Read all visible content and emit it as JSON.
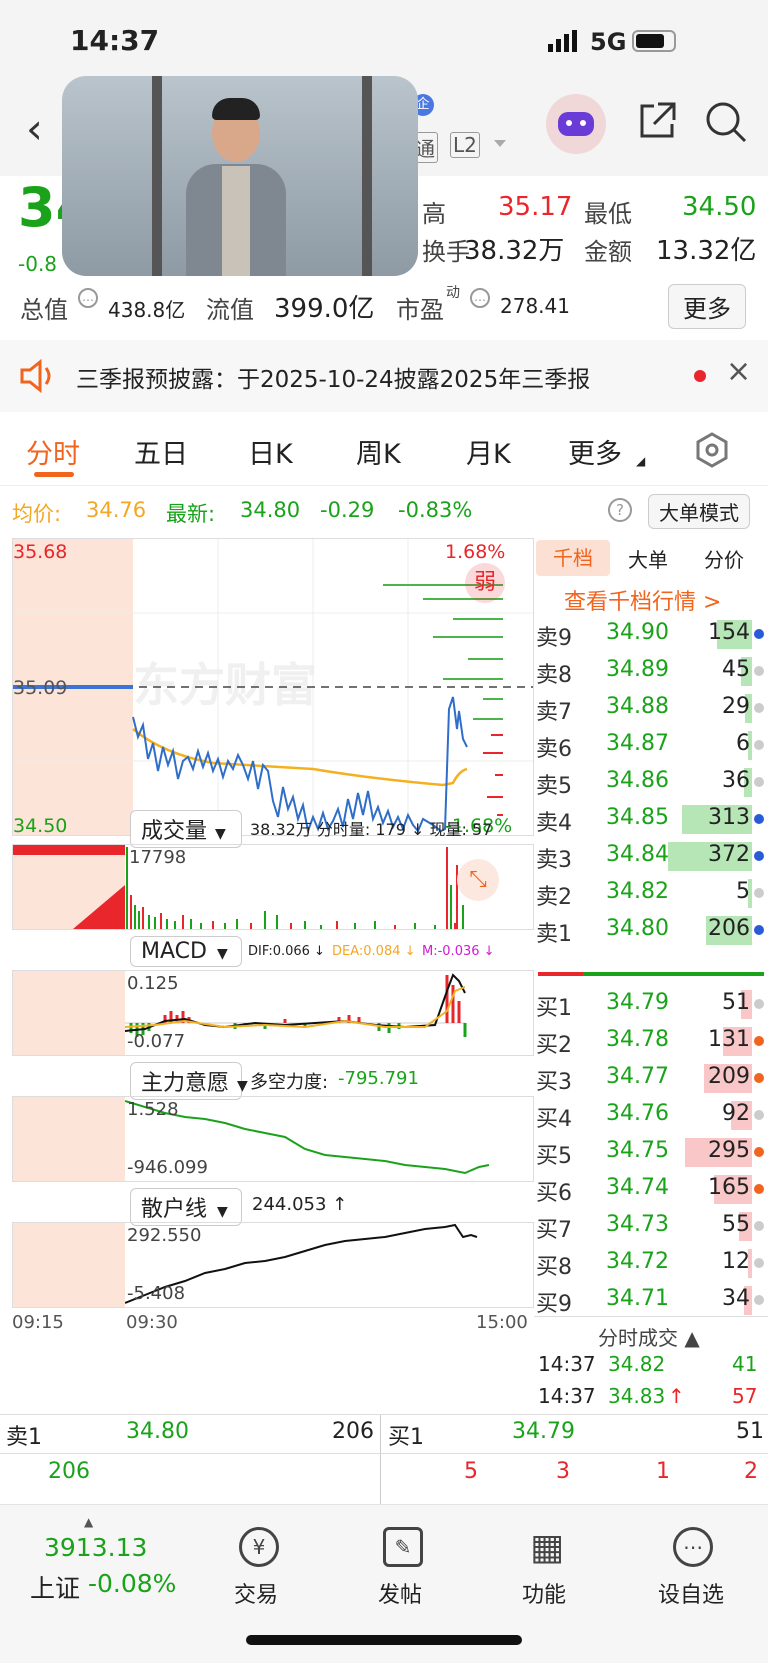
{
  "status": {
    "time": "14:37",
    "network": "5G"
  },
  "header": {
    "title_badge": "企",
    "tag1": "港通",
    "tag2": "L2"
  },
  "quote": {
    "price": "34",
    "change": "-0.8",
    "high_label": "高",
    "high": "35.17",
    "low_label": "最低",
    "low": "34.50",
    "turnover_label": "换手",
    "volume": "38.32万",
    "amount_label": "金额",
    "amount": "13.32亿",
    "mktcap_label": "总值",
    "mktcap": "438.8亿",
    "float_label": "流值",
    "float": "399.0亿",
    "pe_label": "市盈",
    "pe_sup": "动",
    "pe": "278.41",
    "more": "更多"
  },
  "notice": {
    "text": "三季报预披露：于2025-10-24披露2025年三季报"
  },
  "tabs": [
    "分时",
    "五日",
    "日K",
    "周K",
    "月K",
    "更多"
  ],
  "pricebar": {
    "avg_label": "均价:",
    "avg": "34.76",
    "last_label": "最新:",
    "last": "34.80",
    "chg": "-0.29",
    "pct": "-0.83%",
    "mode": "大单模式"
  },
  "chart": {
    "ymax": "35.68",
    "ymid": "35.09",
    "ymin": "34.50",
    "pct_up": "1.68%",
    "pct_dn": "-1.68%",
    "watermark": "东方财富",
    "weak": "弱"
  },
  "volume": {
    "selector": "成交量",
    "info": "38.32万 分时量: 179 ↓ 现量: 57",
    "max": "17798"
  },
  "macd": {
    "selector": "MACD",
    "dif": "DIF:0.066 ↓",
    "dea": "DEA:0.084 ↓",
    "m": "M:-0.036 ↓",
    "top": "0.125",
    "bot": "-0.077"
  },
  "zlyy": {
    "selector": "主力意愿",
    "label": "多空力度:",
    "value": "-795.791",
    "top": "1.528",
    "bot": "-946.099"
  },
  "retail": {
    "selector": "散户线",
    "value": "244.053 ↑",
    "top": "292.550",
    "bot": "-5.408"
  },
  "xaxis": {
    "t1": "09:15",
    "t2": "09:30",
    "t3": "15:00"
  },
  "book": {
    "tabs": [
      "千档",
      "大单",
      "分价"
    ],
    "link": "查看千档行情 >",
    "asks": [
      {
        "label": "卖9",
        "price": "34.90",
        "vol": "154",
        "bar": 0.25,
        "dot": "#2a5bd7"
      },
      {
        "label": "卖8",
        "price": "34.89",
        "vol": "45",
        "bar": 0.08,
        "dot": "#ccc"
      },
      {
        "label": "卖7",
        "price": "34.88",
        "vol": "29",
        "bar": 0.05,
        "dot": "#ccc"
      },
      {
        "label": "卖6",
        "price": "34.87",
        "vol": "6",
        "bar": 0.02,
        "dot": "#ccc"
      },
      {
        "label": "卖5",
        "price": "34.86",
        "vol": "36",
        "bar": 0.06,
        "dot": "#ccc"
      },
      {
        "label": "卖4",
        "price": "34.85",
        "vol": "313",
        "bar": 0.5,
        "dot": "#2a5bd7"
      },
      {
        "label": "卖3",
        "price": "34.84",
        "vol": "372",
        "bar": 0.6,
        "dot": "#2a5bd7"
      },
      {
        "label": "卖2",
        "price": "34.82",
        "vol": "5",
        "bar": 0.02,
        "dot": "#ccc"
      },
      {
        "label": "卖1",
        "price": "34.80",
        "vol": "206",
        "bar": 0.33,
        "dot": "#2a5bd7"
      }
    ],
    "bids": [
      {
        "label": "买1",
        "price": "34.79",
        "vol": "51",
        "bar": 0.08,
        "dot": "#ccc"
      },
      {
        "label": "买2",
        "price": "34.78",
        "vol": "131",
        "bar": 0.21,
        "dot": "#f0641e"
      },
      {
        "label": "买3",
        "price": "34.77",
        "vol": "209",
        "bar": 0.34,
        "dot": "#f0641e"
      },
      {
        "label": "买4",
        "price": "34.76",
        "vol": "92",
        "bar": 0.15,
        "dot": "#ccc"
      },
      {
        "label": "买5",
        "price": "34.75",
        "vol": "295",
        "bar": 0.48,
        "dot": "#f0641e"
      },
      {
        "label": "买6",
        "price": "34.74",
        "vol": "165",
        "bar": 0.27,
        "dot": "#f0641e"
      },
      {
        "label": "买7",
        "price": "34.73",
        "vol": "55",
        "bar": 0.09,
        "dot": "#ccc"
      },
      {
        "label": "买8",
        "price": "34.72",
        "vol": "12",
        "bar": 0.03,
        "dot": "#ccc"
      },
      {
        "label": "买9",
        "price": "34.71",
        "vol": "34",
        "bar": 0.06,
        "dot": "#ccc"
      }
    ],
    "trades_title": "分时成交 ▲",
    "trades": [
      {
        "time": "14:37",
        "price": "34.82",
        "vol": "41",
        "arrow": ""
      },
      {
        "time": "14:37",
        "price": "34.83",
        "vol": "57",
        "arrow": "↑"
      }
    ]
  },
  "bottom": {
    "sell_label": "卖1",
    "sell_price": "34.80",
    "sell_vol": "206",
    "buy_label": "买1",
    "buy_price": "34.79",
    "buy_vol": "51",
    "left_num": "206",
    "right_nums": [
      "5",
      "3",
      "1",
      "2"
    ]
  },
  "tabbar": {
    "index_val": "3913.13",
    "index_name": "上证",
    "index_pct": "-0.08%",
    "items": [
      {
        "label": "交易",
        "glyph": "¥"
      },
      {
        "label": "发帖",
        "glyph": "✎"
      },
      {
        "label": "功能",
        "glyph": "▦"
      },
      {
        "label": "设自选",
        "glyph": "⋯"
      }
    ]
  }
}
